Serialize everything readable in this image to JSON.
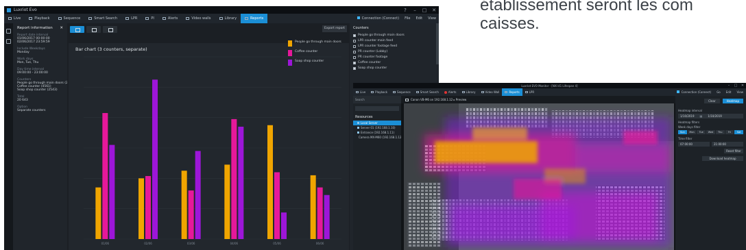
{
  "background_text": {
    "line1": "établissement seront les com",
    "line2": "caisses."
  },
  "colors": {
    "accent": "#1b8fd6",
    "series_orange": "#f0a500",
    "series_pink": "#e6189a",
    "series_purple": "#9d16d8"
  },
  "window1": {
    "title": "Luxriot Evo",
    "nav": [
      {
        "label": "Live",
        "icon": "monitor-icon"
      },
      {
        "label": "Playback",
        "icon": "play-icon"
      },
      {
        "label": "Sequence",
        "icon": "sequence-icon"
      },
      {
        "label": "Smart Search",
        "icon": "smart-search-icon"
      },
      {
        "label": "LPR",
        "icon": "car-icon"
      },
      {
        "label": "PI",
        "icon": "people-icon"
      },
      {
        "label": "Alerts",
        "icon": "alert-icon"
      },
      {
        "label": "Video walls",
        "icon": "video-wall-icon"
      },
      {
        "label": "Library",
        "icon": "library-icon"
      },
      {
        "label": "Reports",
        "icon": "reports-icon",
        "active": true
      }
    ],
    "nav_right": {
      "connection": "Connection (Connect)",
      "items": [
        "File",
        "Edit",
        "View"
      ]
    },
    "left_panel": {
      "title": "Report information",
      "fields": [
        {
          "label": "Report date interval",
          "value": "01/06/2017 00:00:00"
        },
        {
          "label": "",
          "value": "02/06/2017 23:59:59"
        },
        {
          "label": "Include Weekdays",
          "value": "Monday"
        },
        {
          "label": "Work days",
          "value": "Mon, Tue, Thu"
        },
        {
          "label": "Day time interval",
          "value": "09:00:00 - 23:00:00"
        },
        {
          "label": "Counters",
          "value": "People go through main doors (2533)"
        },
        {
          "label": "",
          "value": "Coffee counter (4561)"
        },
        {
          "label": "",
          "value": "Soap shop counter (2543)"
        },
        {
          "label": "Total",
          "value": "20 643"
        },
        {
          "label": "Option",
          "value": "Separate counters"
        }
      ]
    },
    "export_label": "Export report",
    "chart_title": "Bar chart (3 counters, separate)",
    "legend": [
      {
        "name": "People go through main doors",
        "color": "#f0a500"
      },
      {
        "name": "Coffee counter",
        "color": "#e6189a"
      },
      {
        "name": "Soap shop counter",
        "color": "#9d16d8"
      }
    ],
    "counters": {
      "title": "Counters",
      "items": [
        {
          "label": "People go through main doors",
          "checked": true
        },
        {
          "label": "LPR counter main feed",
          "checked": false
        },
        {
          "label": "LPR counter footage feed",
          "checked": false
        },
        {
          "label": "PR counter (Lobby)",
          "checked": false
        },
        {
          "label": "PR counter footage",
          "checked": false
        },
        {
          "label": "Coffee counter",
          "checked": true
        },
        {
          "label": "Soap shop counter",
          "checked": true
        }
      ]
    }
  },
  "window2": {
    "title": "Luxriot EVO Monitor - [NXI 41 Lifespan 4]",
    "nav": [
      {
        "label": "Live",
        "icon": "monitor-icon"
      },
      {
        "label": "Playback",
        "icon": "play-icon"
      },
      {
        "label": "Sequence",
        "icon": "sequence-icon"
      },
      {
        "label": "Smart Search",
        "icon": "smart-search-icon"
      },
      {
        "label": "Alerts",
        "icon": "alert-icon"
      },
      {
        "label": "Library",
        "icon": "library-icon"
      },
      {
        "label": "Video Wall",
        "icon": "video-wall-icon"
      },
      {
        "label": "Reports",
        "icon": "reports-icon",
        "active": true
      },
      {
        "label": "LPR",
        "icon": "car-icon"
      }
    ],
    "nav_right": {
      "connection": "Connection (Connect)",
      "items": [
        "Go",
        "Edit",
        "View"
      ]
    },
    "left_panel": {
      "header": "Search",
      "search_placeholder": "",
      "title": "Resources",
      "tree": [
        {
          "label": "Local Server",
          "selected": true
        },
        {
          "label": "Server 01 (192.168.1.10)"
        },
        {
          "label": "Entrance (192.168.1.11)"
        },
        {
          "label": "Camera MX-M60 (192.168.1.12)"
        }
      ]
    },
    "camera_label": "Canon VB-M6 on 192.168.1.12 ▸ Preview",
    "right_panel": {
      "buttons": [
        "Clear",
        "Heatmap"
      ],
      "interval_label": "Heatmap interval",
      "date_from": "1/10/2019",
      "date_to": "1/10/2019",
      "filters_label": "Heatmap filters",
      "days_label": "Week days filter",
      "days": [
        {
          "label": "Sun",
          "on": true
        },
        {
          "label": "Mon",
          "on": false
        },
        {
          "label": "Tue",
          "on": false
        },
        {
          "label": "Wed",
          "on": false
        },
        {
          "label": "Thu",
          "on": false
        },
        {
          "label": "Fri",
          "on": false
        },
        {
          "label": "Sat",
          "on": true
        }
      ],
      "time_label": "Time filter",
      "time_from": "07:00:00",
      "time_to": "21:00:00",
      "reset_label": "Reset filter",
      "download_label": "Download heatmap"
    }
  },
  "chart_data": {
    "type": "bar",
    "title": "Bar chart (3 counters, separate)",
    "categories": [
      "01/06",
      "02/06",
      "03/06",
      "04/06",
      "05/06",
      "06/06"
    ],
    "ylim": [
      0,
      1200
    ],
    "series": [
      {
        "name": "People go through main doors",
        "color": "#f0a500",
        "values": [
          340,
          400,
          450,
          490,
          750,
          420
        ]
      },
      {
        "name": "Coffee counter",
        "color": "#e6189a",
        "values": [
          830,
          415,
          320,
          790,
          440,
          340
        ]
      },
      {
        "name": "Soap shop counter",
        "color": "#9d16d8",
        "values": [
          620,
          1050,
          580,
          740,
          175,
          290
        ]
      }
    ],
    "grid": true
  }
}
